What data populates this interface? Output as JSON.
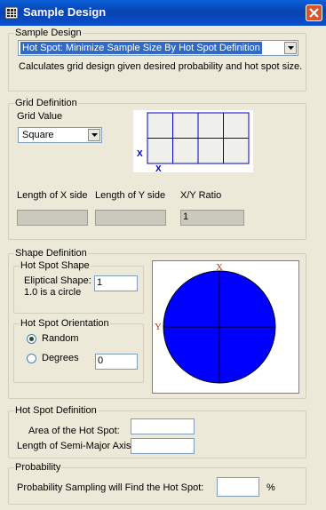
{
  "window": {
    "title": "Sample Design",
    "close_icon": "close-icon",
    "app_icon": "grid-app-icon"
  },
  "sample_design": {
    "legend": "Sample Design",
    "selected": "Hot Spot: Minimize Sample Size By Hot Spot Definition",
    "description": "Calculates grid design given desired probability and hot spot size."
  },
  "grid_definition": {
    "legend": "Grid Definition",
    "grid_value_label": "Grid Value",
    "grid_value": "Square",
    "diagram": {
      "x_marker": "X",
      "y_marker": "X",
      "color": "#0000cc"
    },
    "x_side_label": "Length of X side",
    "y_side_label": "Length of Y side",
    "ratio_label": "X/Y Ratio",
    "x_side_value": "",
    "y_side_value": "",
    "ratio_value": "1"
  },
  "shape_definition": {
    "legend": "Shape Definition",
    "hot_spot_shape": {
      "legend": "Hot Spot Shape",
      "elliptical_label_line1": "Eliptical Shape:",
      "elliptical_label_line2": "1.0 is a circle",
      "elliptical_value": "1"
    },
    "orientation": {
      "legend": "Hot Spot Orientation",
      "random_label": "Random",
      "degrees_label": "Degrees",
      "degrees_value": "0",
      "selected": "Random"
    },
    "preview": {
      "x_label": "X",
      "y_label": "Y",
      "fill": "#0000ff",
      "label_color": "#b04000"
    }
  },
  "hot_spot_definition": {
    "legend": "Hot Spot Definition",
    "area_label": "Area of the Hot Spot:",
    "area_value": "",
    "semi_major_label": "Length of Semi-Major Axis:",
    "semi_major_value": ""
  },
  "probability": {
    "legend": "Probability",
    "label": "Probability Sampling will Find the Hot Spot:",
    "value": "",
    "unit": "%"
  }
}
